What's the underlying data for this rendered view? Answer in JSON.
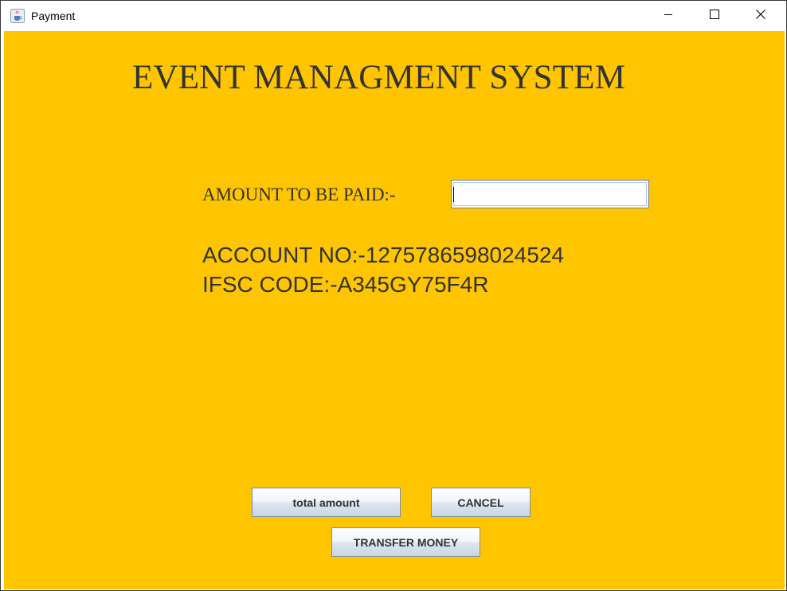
{
  "window": {
    "title": "Payment",
    "app_icon": "java-coffee-cup-icon",
    "controls": {
      "minimize_icon": "minimize-icon",
      "maximize_icon": "maximize-icon",
      "close_icon": "close-icon"
    }
  },
  "colors": {
    "background": "#ffc500",
    "text": "#333333",
    "titlebar": "#ffffff"
  },
  "main": {
    "heading": "EVENT MANAGMENT SYSTEM",
    "amount_label": "AMOUNT TO BE PAID:-",
    "amount_value": "",
    "account_no": "ACCOUNT NO:-1275786598024524",
    "ifsc_code": "IFSC CODE:-A345GY75F4R"
  },
  "buttons": {
    "total_amount": "total amount",
    "cancel": "CANCEL",
    "transfer_money": "TRANSFER MONEY"
  }
}
